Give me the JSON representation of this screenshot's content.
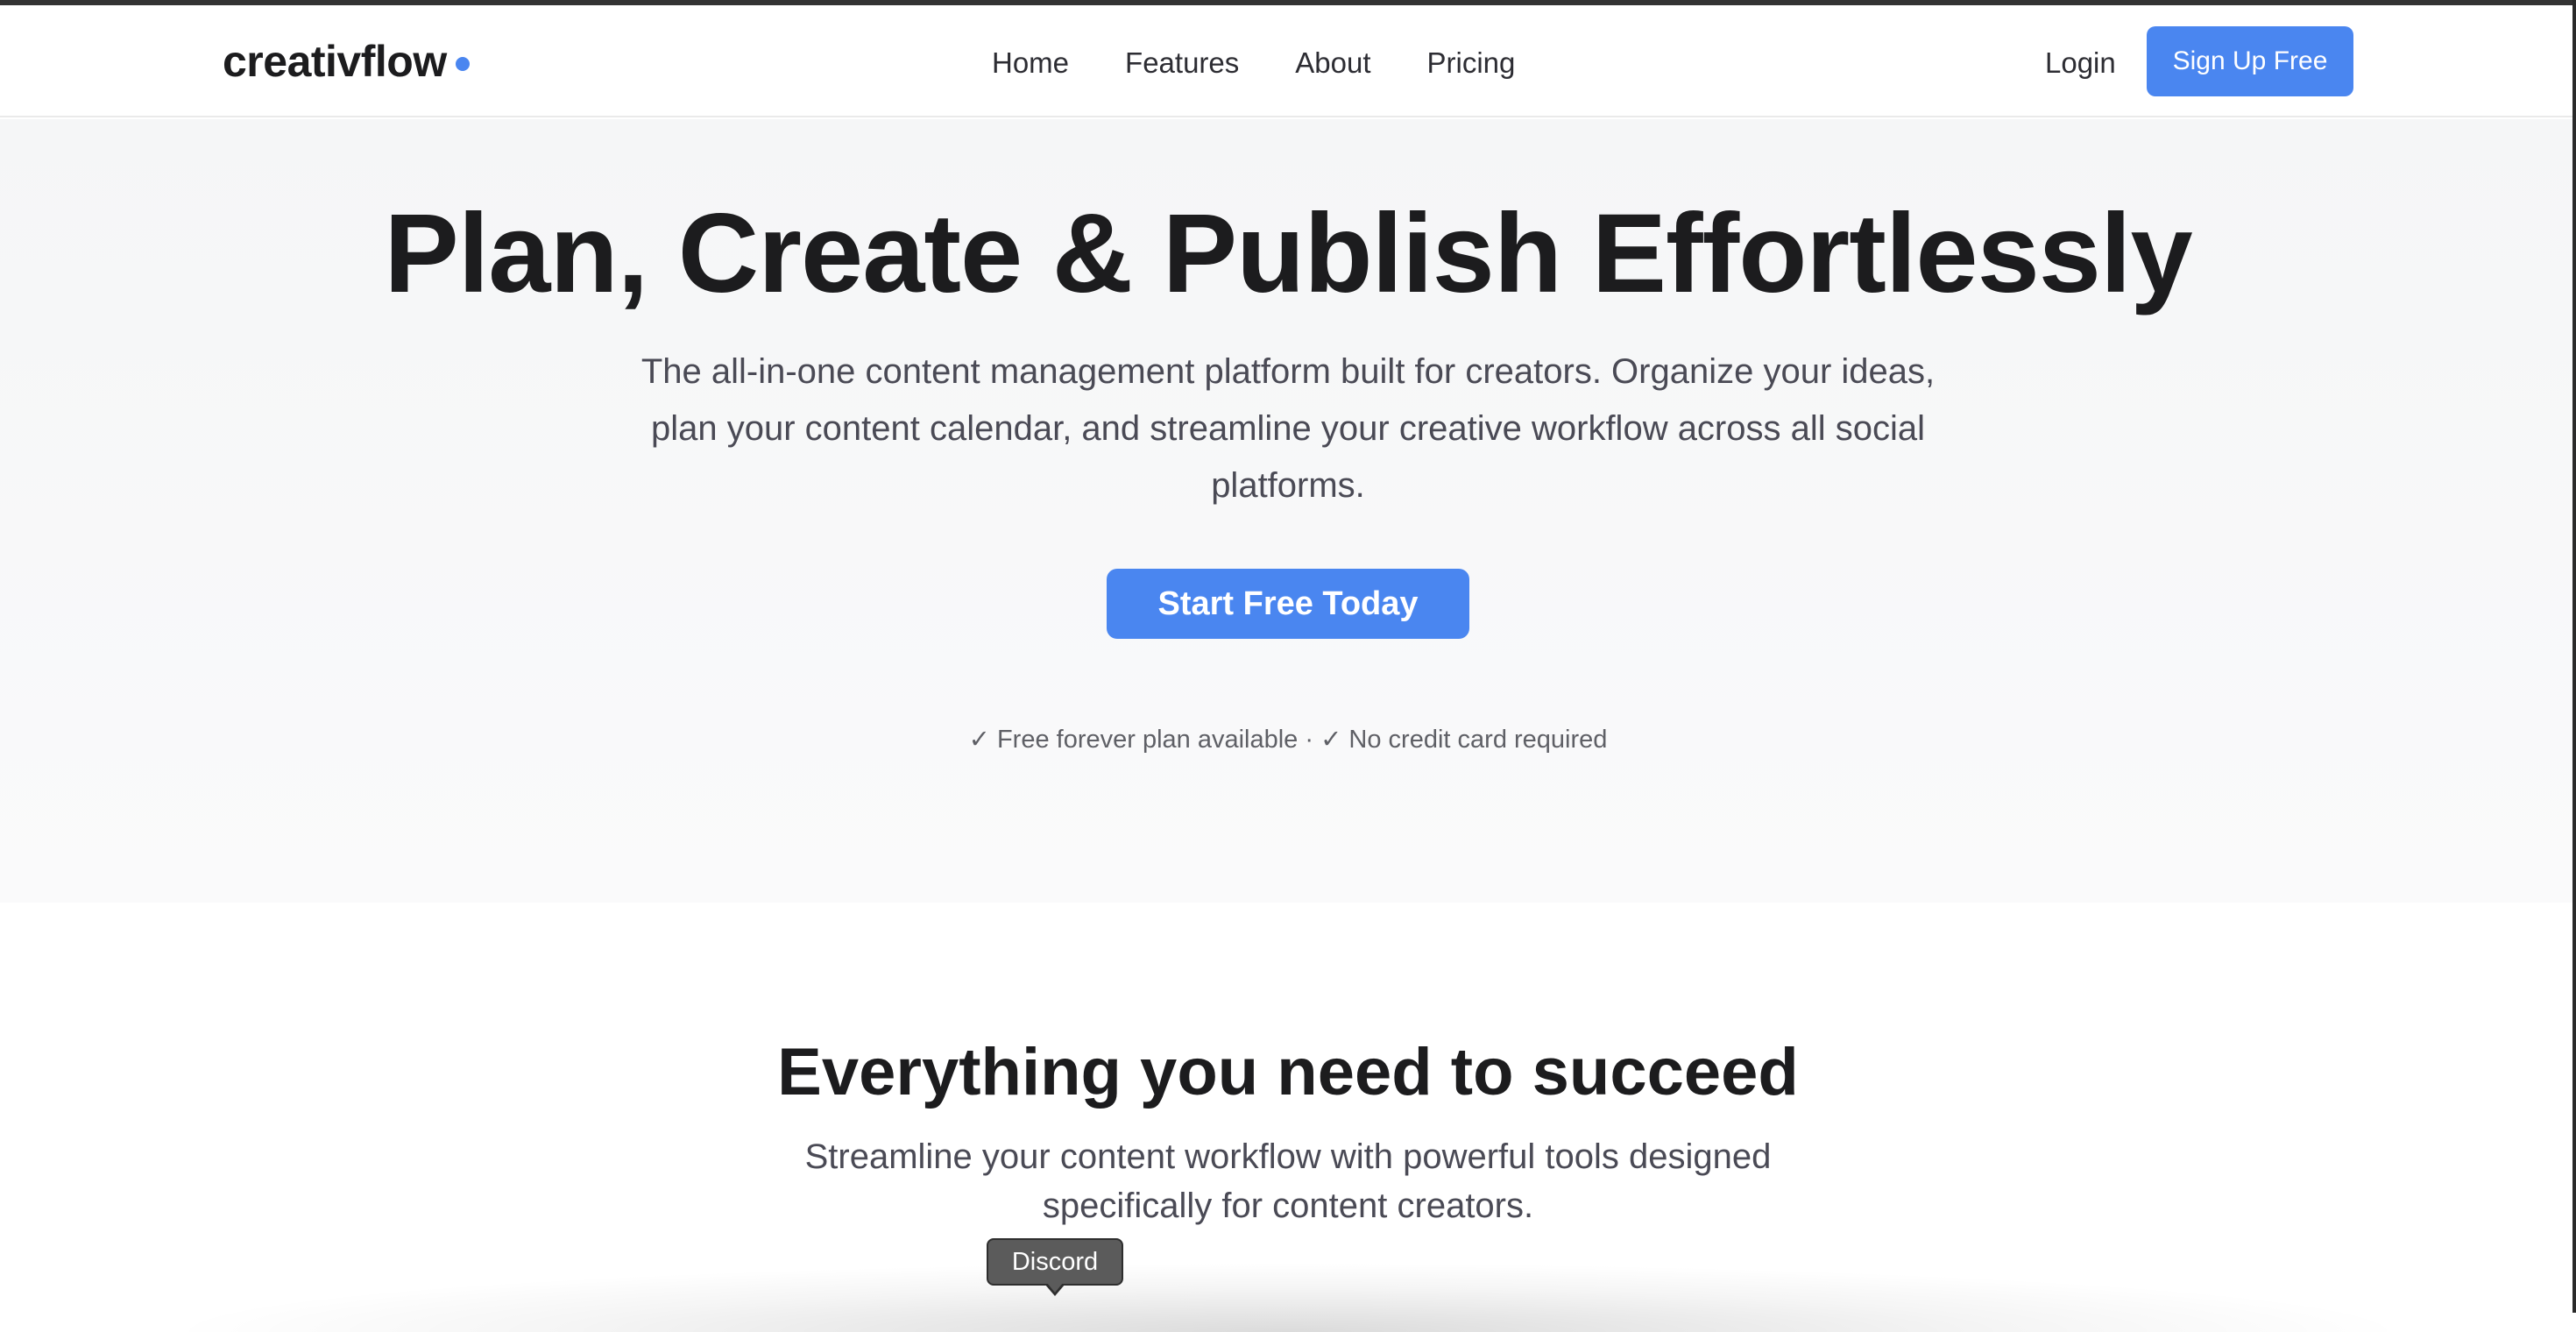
{
  "brand": {
    "name": "creativflow",
    "accent_color": "#4a86f0"
  },
  "nav": {
    "links": [
      "Home",
      "Features",
      "About",
      "Pricing"
    ],
    "login_label": "Login",
    "signup_label": "Sign Up Free"
  },
  "hero": {
    "title": "Plan, Create & Publish Effortlessly",
    "subtitle": "The all-in-one content management platform built for creators. Organize your ideas, plan your content calendar, and streamline your creative workflow across all social platforms.",
    "cta_label": "Start Free Today",
    "note": "✓ Free forever plan available · ✓ No credit card required"
  },
  "features": {
    "title": "Everything you need to succeed",
    "subtitle": "Streamline your content workflow with powerful tools designed specifically for content creators."
  },
  "tooltip": {
    "text": "Discord"
  }
}
